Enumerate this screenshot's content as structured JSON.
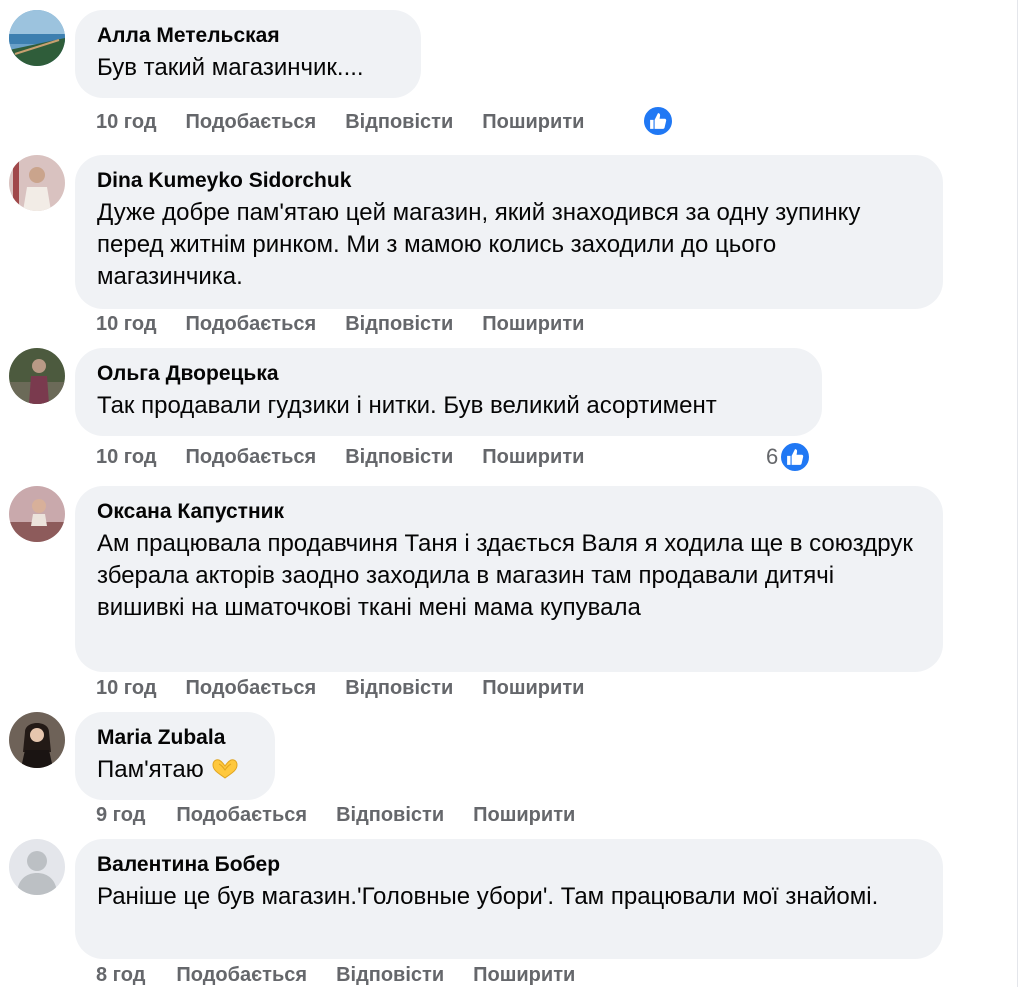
{
  "actions": {
    "like_label": "Подобається",
    "reply_label": "Відповісти",
    "share_label": "Поширити"
  },
  "comments": [
    {
      "author": "Алла Метельская",
      "text": "Був такий магазинчик....",
      "time": "10 год"
    },
    {
      "author": "Dina Kumeyko Sidorchuk",
      "text": "Дуже добре пам'ятаю цей магазин, який знаходився за одну зупинку перед житнім ринком. Ми з мамою колись заходили до цього магазинчика.",
      "time": "10 год"
    },
    {
      "author": "Ольга Дворецька",
      "text": "Так продавали гудзики і нитки. Був великий асортимент",
      "time": "10 год",
      "reaction_count": "6"
    },
    {
      "author": "Оксана Капустник",
      "text": "Ам працювала продавчиня Таня і здається Валя я ходила ще в союздрук зберала акторів заодно заходила в магазин там продавали дитячі вишивкі на шматочкові ткані мені мама купувала",
      "time": "10 год"
    },
    {
      "author": "Maria Zubala",
      "text": "Пам'ятаю",
      "time": "9 год",
      "emoji": "heart-hands"
    },
    {
      "author": "Валентина Бобер",
      "text": "Раніше це був магазин.'Головные убори'. Там працювали мої знайомі.",
      "time": "8 год"
    }
  ],
  "colors": {
    "bubble": "#f0f2f5",
    "meta_text": "#65676b",
    "like_blue": "#2078f4"
  }
}
